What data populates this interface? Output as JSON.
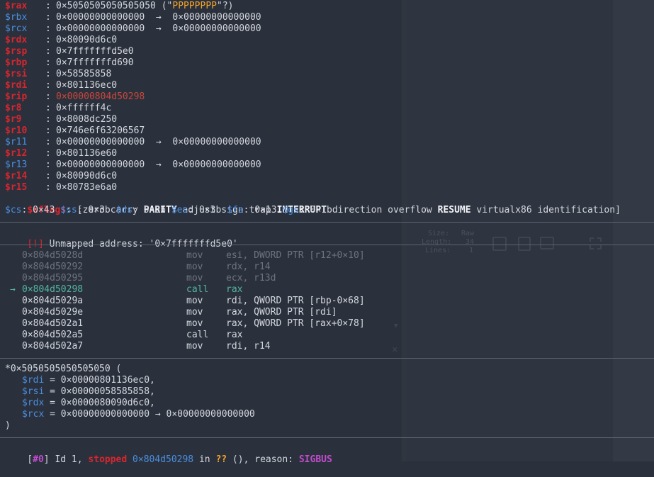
{
  "registers": [
    {
      "name": "$rax",
      "value": "0×5050505050505050",
      "extra_open": " (\"",
      "extra_str": "PPPPPPPP",
      "extra_close": "\"?)",
      "style": "red"
    },
    {
      "name": "$rbx",
      "value": "0×00000000000000",
      "arrow": "  →  ",
      "deref": "0×00000000000000",
      "style": "blue"
    },
    {
      "name": "$rcx",
      "value": "0×00000000000000",
      "arrow": "  →  ",
      "deref": "0×00000000000000",
      "style": "blue"
    },
    {
      "name": "$rdx",
      "value": "0×80090d6c0",
      "style": "red"
    },
    {
      "name": "$rsp",
      "value": "0×7fffffffd5e0",
      "style": "red"
    },
    {
      "name": "$rbp",
      "value": "0×7fffffffd690",
      "style": "red"
    },
    {
      "name": "$rsi",
      "value": "0×58585858",
      "style": "red"
    },
    {
      "name": "$rdi",
      "value": "0×801136ec0",
      "style": "red"
    },
    {
      "name": "$rip",
      "value": "0×00000804d50298",
      "style": "red",
      "value_style": "rip"
    },
    {
      "name": "$r8",
      "value": "0×ffffff4c",
      "style": "red"
    },
    {
      "name": "$r9",
      "value": "0×8008dc250",
      "style": "red"
    },
    {
      "name": "$r10",
      "value": "0×746e6f63206567",
      "style": "red"
    },
    {
      "name": "$r11",
      "value": "0×00000000000000",
      "arrow": "  →  ",
      "deref": "0×00000000000000",
      "style": "blue"
    },
    {
      "name": "$r12",
      "value": "0×801136e60",
      "style": "red"
    },
    {
      "name": "$r13",
      "value": "0×00000000000000",
      "arrow": "  →  ",
      "deref": "0×00000000000000",
      "style": "blue"
    },
    {
      "name": "$r14",
      "value": "0×80090d6c0",
      "style": "red"
    },
    {
      "name": "$r15",
      "value": "0×80783e6a0",
      "style": "red"
    }
  ],
  "eflags": {
    "name": "$eflags",
    "sep": ": [",
    "flags": [
      {
        "t": "zero",
        "on": false
      },
      {
        "t": "carry",
        "on": false
      },
      {
        "t": "PARITY",
        "on": true
      },
      {
        "t": "adjust",
        "on": false
      },
      {
        "t": "sign",
        "on": false
      },
      {
        "t": "trap",
        "on": false
      },
      {
        "t": "INTERRUPT",
        "on": true
      },
      {
        "t": "direction",
        "on": false
      },
      {
        "t": "overflow",
        "on": false
      },
      {
        "t": "RESUME",
        "on": true
      },
      {
        "t": "virtualx86",
        "on": false
      },
      {
        "t": "identification",
        "on": false
      }
    ],
    "close": "]"
  },
  "segments": [
    {
      "name": "$cs",
      "value": "0×43"
    },
    {
      "name": "$ss",
      "value": "0×3b"
    },
    {
      "name": "$ds",
      "value": "0×3b"
    },
    {
      "name": "$es",
      "value": "0×3b"
    },
    {
      "name": "$fs",
      "value": "0×13"
    },
    {
      "name": "$gs",
      "value": "0×1b"
    }
  ],
  "warning": {
    "tag": "[!]",
    "text": " Unmapped address: '0×7fffffffd5e0'"
  },
  "disasm": [
    {
      "addr": "0×804d5028d",
      "mn": "mov",
      "op": "esi, DWORD PTR [r12+0×10]",
      "state": "past"
    },
    {
      "addr": "0×804d50292",
      "mn": "mov",
      "op": "rdx, r14",
      "state": "past"
    },
    {
      "addr": "0×804d50295",
      "mn": "mov",
      "op": "ecx, r13d",
      "state": "past"
    },
    {
      "addr": "0×804d50298",
      "mn": "call",
      "op": "rax",
      "state": "current",
      "marker": "→"
    },
    {
      "addr": "0×804d5029a",
      "mn": "mov",
      "op": "rdi, QWORD PTR [rbp-0×68]",
      "state": "next"
    },
    {
      "addr": "0×804d5029e",
      "mn": "mov",
      "op": "rax, QWORD PTR [rdi]",
      "state": "next"
    },
    {
      "addr": "0×804d502a1",
      "mn": "mov",
      "op": "rax, QWORD PTR [rax+0×78]",
      "state": "next"
    },
    {
      "addr": "0×804d502a5",
      "mn": "call",
      "op": "rax",
      "state": "next"
    },
    {
      "addr": "0×804d502a7",
      "mn": "mov",
      "op": "rdi, r14",
      "state": "next"
    }
  ],
  "call": {
    "target": "*0×5050505050505050 (",
    "args": [
      {
        "reg": "$rdi",
        "eq": " = ",
        "val": "0×00000801136ec0,"
      },
      {
        "reg": "$rsi",
        "eq": " = ",
        "val": "0×00000058585858,"
      },
      {
        "reg": "$rdx",
        "eq": " = ",
        "val": "0×0000080090d6c0,"
      },
      {
        "reg": "$rcx",
        "eq": " = ",
        "val": "0×00000000000000 → 0×00000000000000"
      }
    ],
    "close": ")"
  },
  "thread": {
    "id_open": "[",
    "id": "#0",
    "id_close": "]",
    "prefix": " Id 1, ",
    "state": "stopped",
    "addr": " 0×804d50298",
    "in": " in ",
    "func": "??",
    "paren": " (), reason: ",
    "reason": "SIGBUS"
  },
  "ghost": {
    "size_label": "Size:",
    "size_val": "Raw",
    "length_label": "Length:",
    "length_val": "34",
    "lines_label": "Lines:",
    "lines_val": "1"
  }
}
